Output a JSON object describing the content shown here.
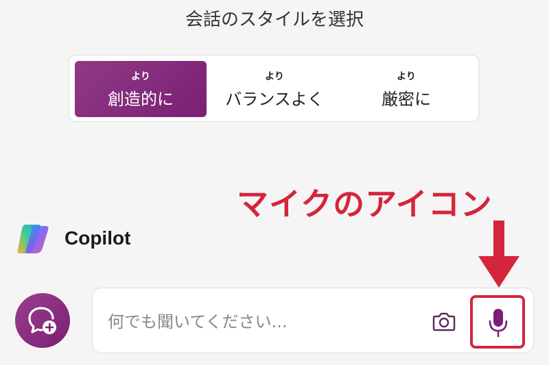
{
  "header": {
    "title": "会話のスタイルを選択"
  },
  "style_options": [
    {
      "small": "より",
      "label": "創造的に",
      "selected": true
    },
    {
      "small": "より",
      "label": "バランスよく",
      "selected": false
    },
    {
      "small": "より",
      "label": "厳密に",
      "selected": false
    }
  ],
  "annotation": {
    "text": "マイクのアイコン",
    "color": "#d3263c"
  },
  "brand": {
    "name": "Copilot"
  },
  "input": {
    "placeholder": "何でも聞いてください..."
  },
  "icons": {
    "new_chat": "chat-plus-icon",
    "camera": "camera-icon",
    "mic": "microphone-icon",
    "logo": "copilot-logo-icon"
  },
  "colors": {
    "accent": "#7b1f75",
    "highlight": "#d3263c"
  }
}
